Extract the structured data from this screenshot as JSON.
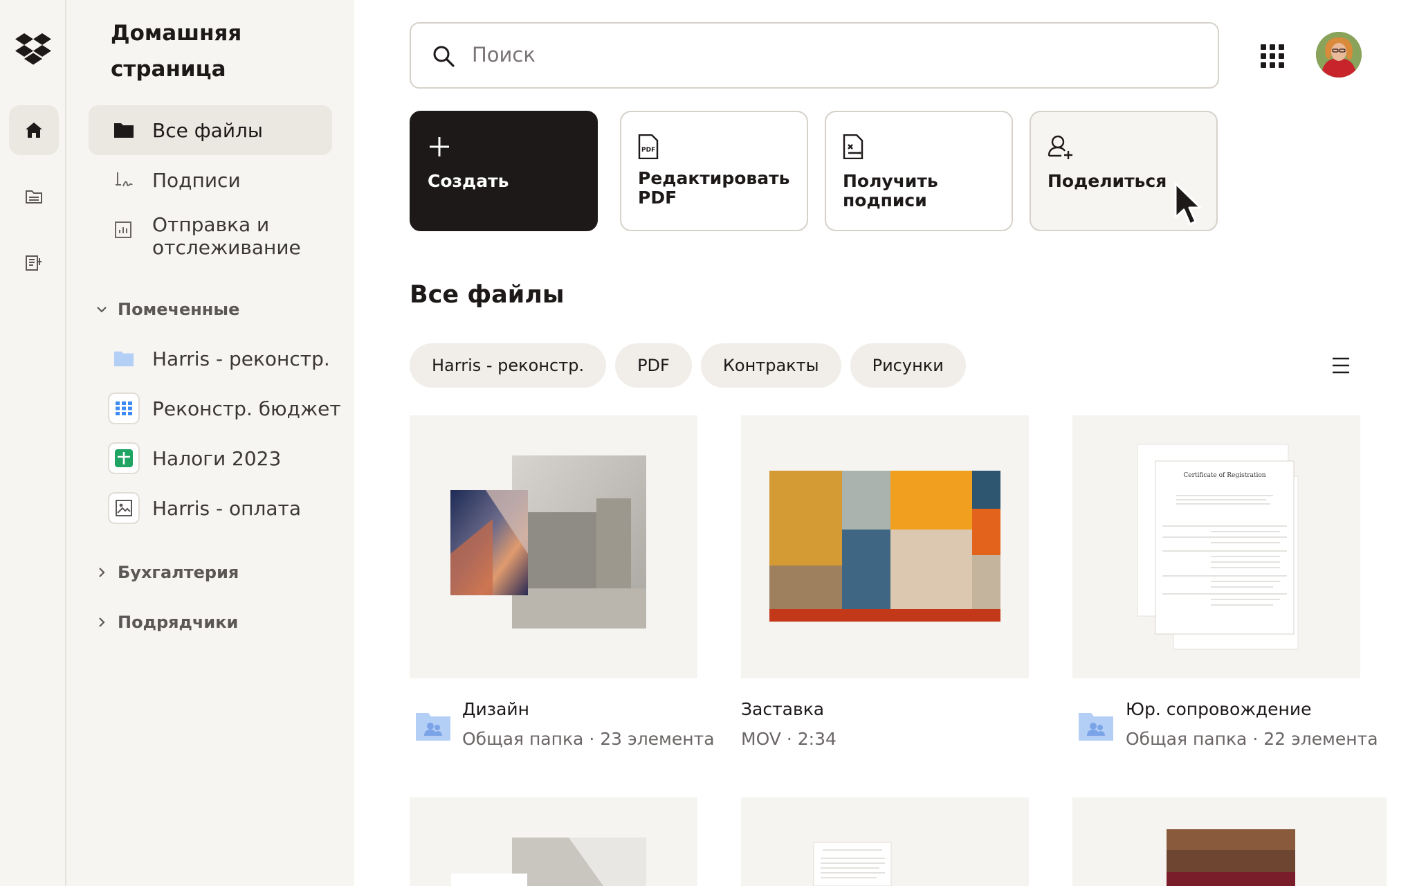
{
  "sidebar": {
    "title": "Домашняя страница",
    "nav": [
      {
        "label": "Все файлы",
        "icon": "folder-icon",
        "active": true
      },
      {
        "label": "Подписи",
        "icon": "signature-icon"
      },
      {
        "label": "Отправка и отслеживание",
        "icon": "chart-icon"
      }
    ],
    "starred_label": "Помеченные",
    "starred": [
      {
        "label": "Harris - реконстр.",
        "icon": "folder-icon"
      },
      {
        "label": "Реконстр. бюджет",
        "icon": "spreadsheet-icon"
      },
      {
        "label": "Налоги 2023",
        "icon": "green-sheet-icon"
      },
      {
        "label": "Harris - оплата",
        "icon": "image-file-icon"
      }
    ],
    "sections": [
      "Бухгалтерия",
      "Подрядчики"
    ]
  },
  "search": {
    "placeholder": "Поиск"
  },
  "actions": [
    {
      "label": "Создать",
      "icon": "plus-icon"
    },
    {
      "label": "Редактировать PDF",
      "icon": "pdf-icon"
    },
    {
      "label": "Получить подписи",
      "icon": "sign-doc-icon"
    },
    {
      "label": "Поделиться",
      "icon": "share-user-icon"
    }
  ],
  "main": {
    "title": "Все файлы",
    "filters": [
      "Harris - реконстр.",
      "PDF",
      "Контракты",
      "Рисунки"
    ]
  },
  "files": [
    {
      "name": "Дизайн",
      "meta": "Общая папка · 23 элемента",
      "icon": "shared-folder-icon"
    },
    {
      "name": "Заставка",
      "meta": "MOV · 2:34"
    },
    {
      "name": "Юр. сопровождение",
      "meta": "Общая папка · 22 элемента",
      "icon": "shared-folder-icon"
    }
  ],
  "document_preview": {
    "title": "Certificate of Registration"
  },
  "colors": {
    "accent_dark": "#1e1919",
    "sidebar_bg": "#f7f5f2",
    "folder_blue": "#b4cff6"
  }
}
